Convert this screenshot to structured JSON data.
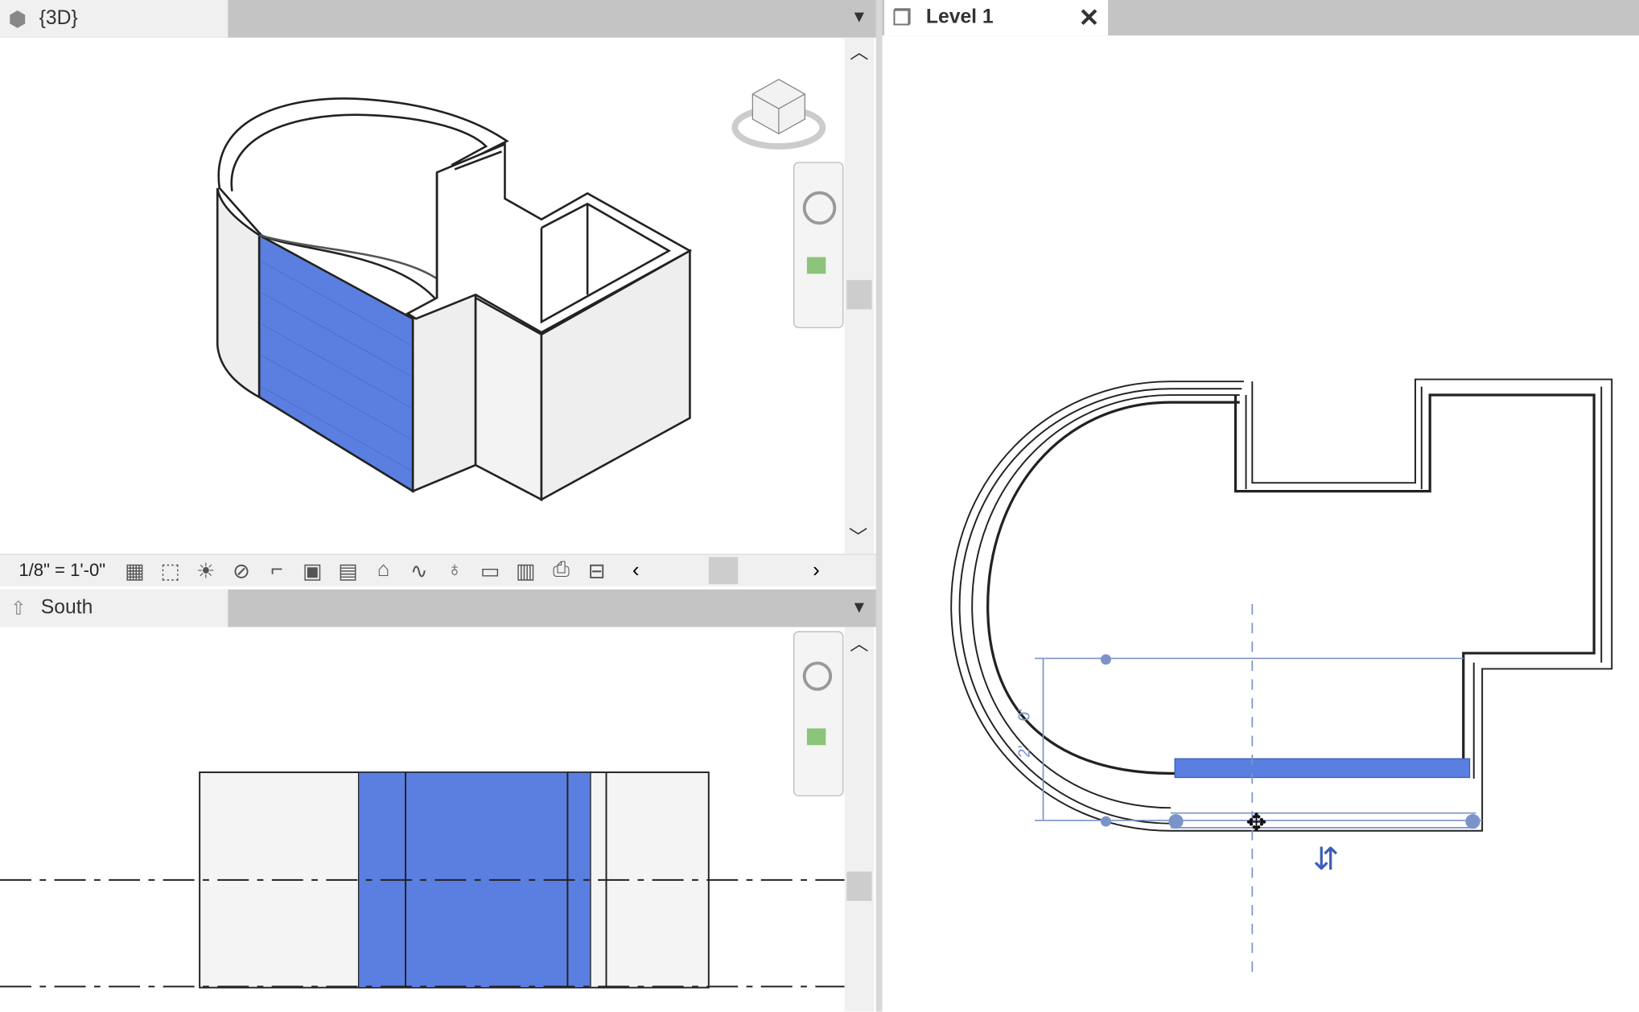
{
  "views": {
    "three_d": {
      "tab_label": "{3D}",
      "scale": "1/8\" = 1'-0\""
    },
    "south": {
      "tab_label": "South"
    },
    "level1": {
      "tab_label": "Level 1",
      "close_icon": "close-icon"
    }
  },
  "colors": {
    "selection": "#5b7fe0",
    "header_bg": "#c4c4c4",
    "tab_bg": "#f0f0f0",
    "plan_control": "#7b93c9"
  },
  "plan": {
    "dim_label_1": "0'",
    "dim_label_2": "2'"
  },
  "status_icons": [
    "visual-style-icon",
    "section-box-icon",
    "sun-path-icon",
    "shadows-icon",
    "crop-icon",
    "hide-crop-icon",
    "unlock-view-icon",
    "temporary-hide-icon",
    "reveal-hidden-icon",
    "lock-3d-icon",
    "analytical-model-icon",
    "highlight-displacement-icon",
    "reveal-constraints-icon",
    "worksharing-icon"
  ]
}
